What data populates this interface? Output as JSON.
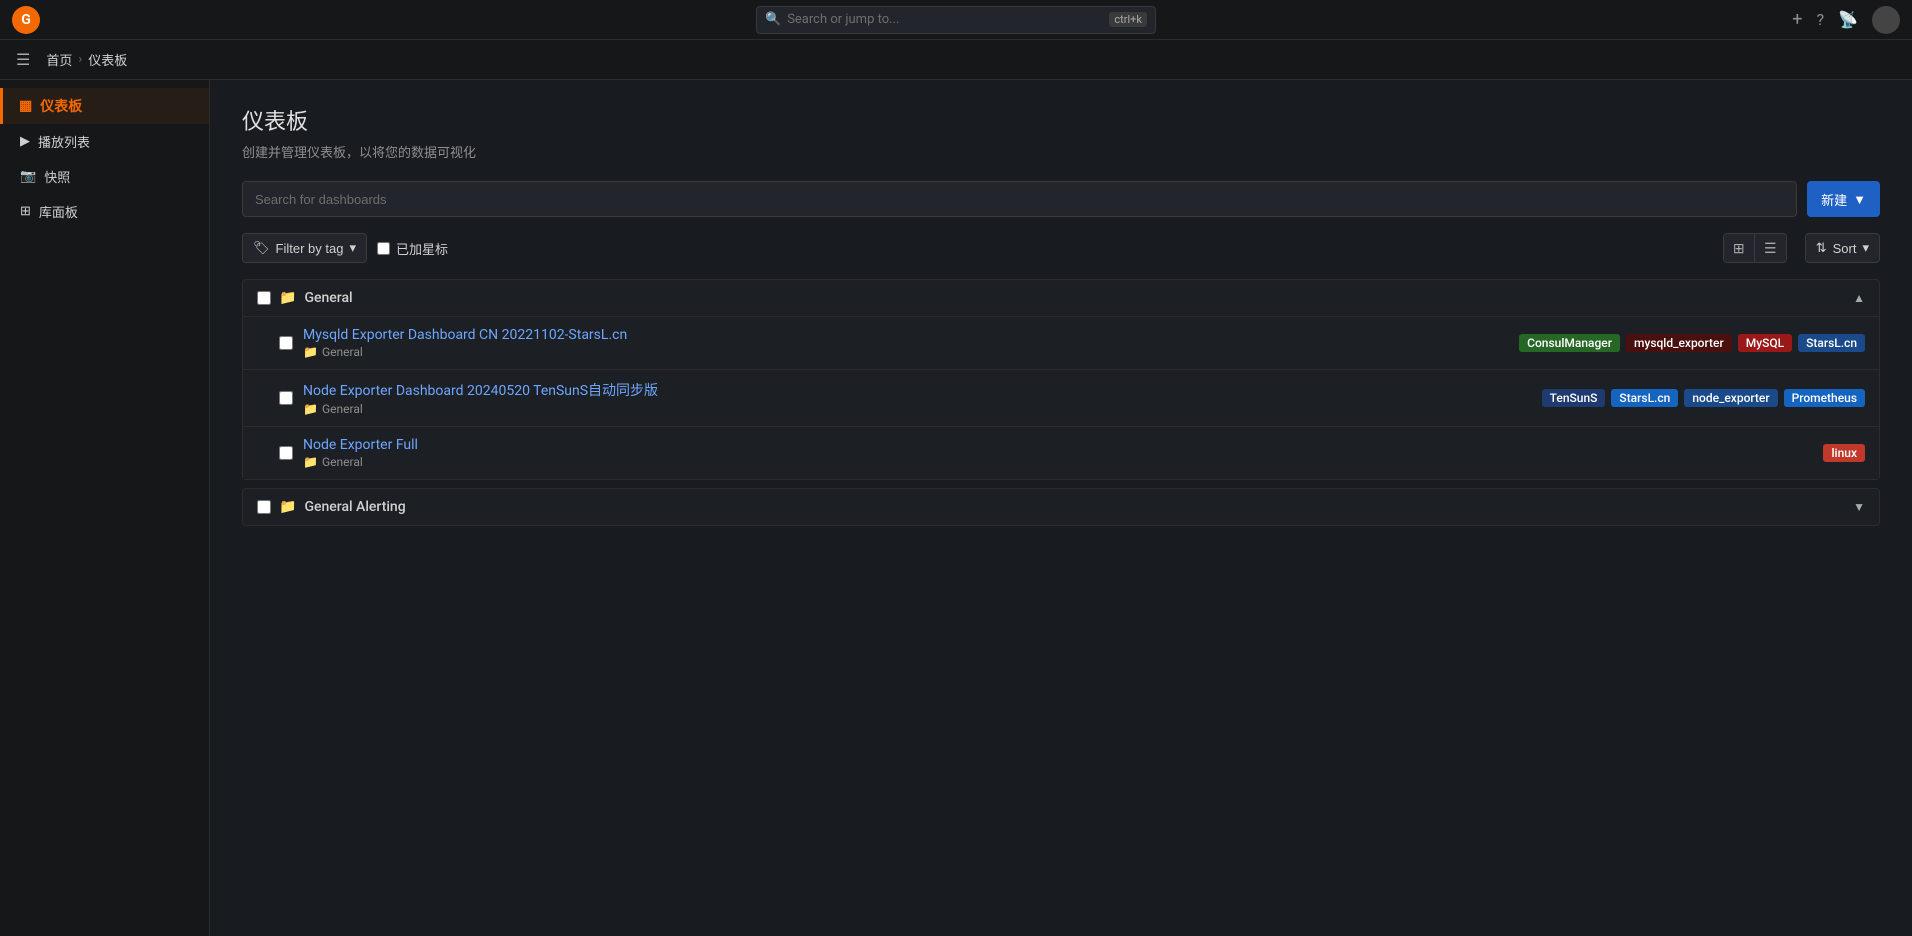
{
  "topnav": {
    "logo_label": "G",
    "search_placeholder": "Search or jump to...",
    "shortcut": "ctrl+k",
    "add_label": "+",
    "help_icon": "?",
    "bell_icon": "🔔",
    "avatar_label": ""
  },
  "breadcrumb": {
    "home": "首页",
    "separator": "›",
    "current": "仪表板"
  },
  "sidebar": {
    "section_label": "仪表板",
    "section_icon": "▦",
    "items": [
      {
        "label": "播放列表",
        "icon": "▶"
      },
      {
        "label": "快照",
        "icon": "📷"
      },
      {
        "label": "库面板",
        "icon": "⊞"
      }
    ]
  },
  "page": {
    "title": "仪表板",
    "subtitle": "创建并管理仪表板，以将您的数据可视化",
    "search_placeholder": "Search for dashboards",
    "new_button_label": "新建",
    "filter_by_tag_label": "Filter by tag",
    "starred_label": "已加星标",
    "sort_label": "Sort",
    "view_card_icon": "⊞",
    "view_list_icon": "☰"
  },
  "folders": [
    {
      "name": "General",
      "collapsed": false,
      "dashboards": [
        {
          "name": "Mysqld Exporter Dashboard CN 20221102-StarsL.cn",
          "folder": "General",
          "tags": [
            {
              "label": "ConsulManager",
              "color_class": "tag-green"
            },
            {
              "label": "mysqld_exporter",
              "color_class": "tag-dark"
            },
            {
              "label": "MySQL",
              "color_class": "tag-red"
            },
            {
              "label": "StarsL.cn",
              "color_class": "tag-blue"
            }
          ]
        },
        {
          "name": "Node Exporter Dashboard 20240520 TenSunS自动同步版",
          "folder": "General",
          "tags": [
            {
              "label": "TenSunS",
              "color_class": "tag-darkblue"
            },
            {
              "label": "StarsL.cn",
              "color_class": "tag-orange"
            },
            {
              "label": "node_exporter",
              "color_class": "tag-blue"
            },
            {
              "label": "Prometheus",
              "color_class": "tag-prometheus"
            }
          ]
        },
        {
          "name": "Node Exporter Full",
          "folder": "General",
          "tags": [
            {
              "label": "linux",
              "color_class": "tag-linux"
            }
          ]
        }
      ]
    },
    {
      "name": "General Alerting",
      "collapsed": true,
      "dashboards": []
    }
  ]
}
